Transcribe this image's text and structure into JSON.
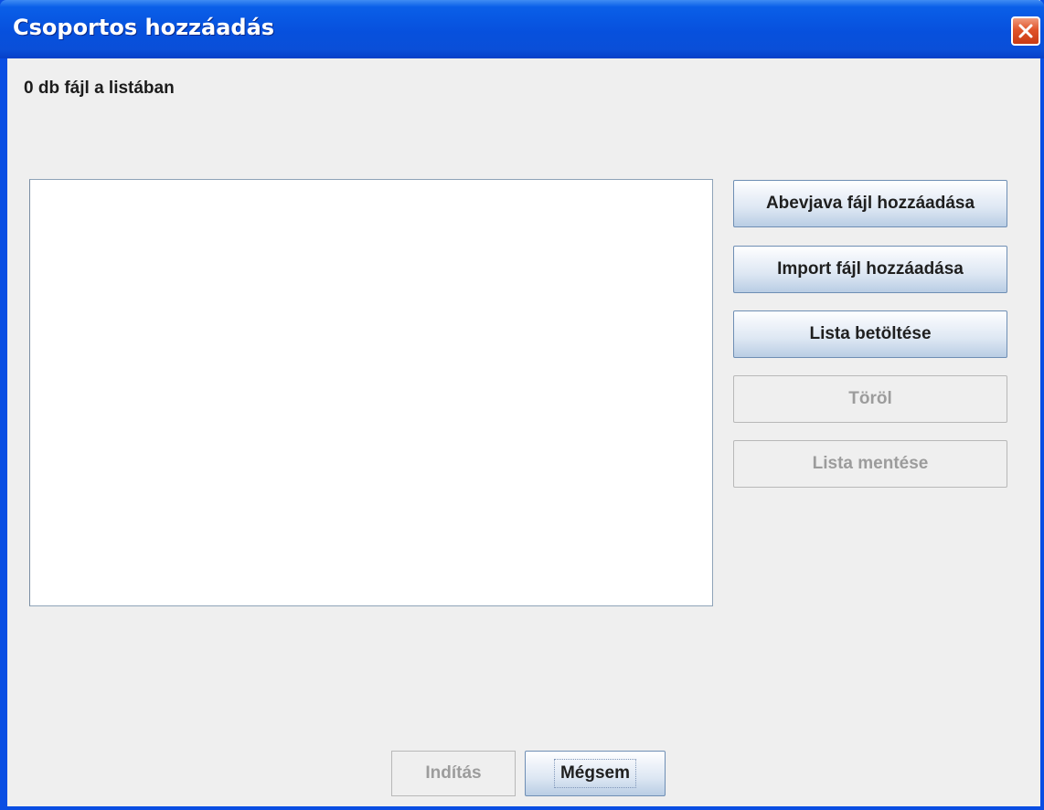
{
  "window": {
    "title": "Csoportos hozzáadás"
  },
  "status": {
    "file_count_text": "0 db fájl a listában"
  },
  "side_buttons": [
    {
      "label": "Abevjava fájl hozzáadása",
      "enabled": true
    },
    {
      "label": "Import fájl hozzáadása",
      "enabled": true
    },
    {
      "label": "Lista betöltése",
      "enabled": true
    },
    {
      "label": "Töröl",
      "enabled": false
    },
    {
      "label": "Lista mentése",
      "enabled": false
    }
  ],
  "footer": {
    "start_label": "Indítás",
    "cancel_label": "Mégsem"
  },
  "colors": {
    "title_bar": "#0750dd",
    "window_bg": "#efefef",
    "close_button": "#e0542a"
  },
  "icons": {
    "close": "close-icon"
  }
}
